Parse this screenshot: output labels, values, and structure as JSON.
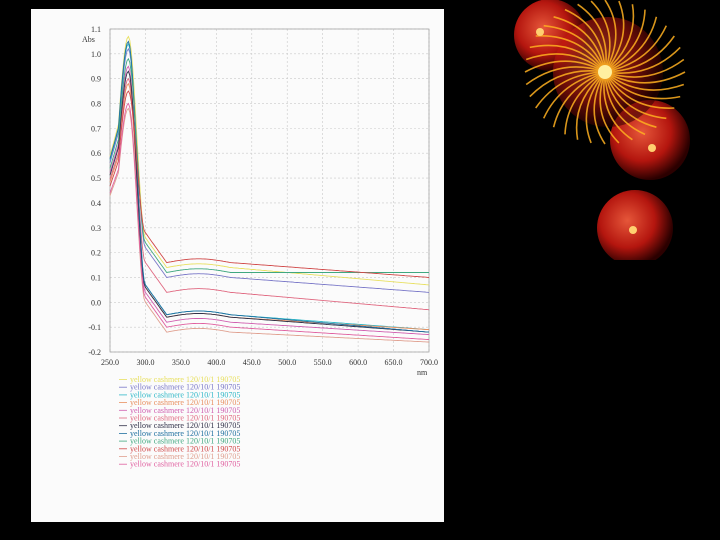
{
  "chart_data": {
    "type": "line",
    "ylabel": "Abs",
    "xlabel": "nm",
    "xlim": [
      250,
      700
    ],
    "ylim": [
      -0.2,
      1.1
    ],
    "xticks": [
      "250.0",
      "300.0",
      "350.0",
      "400.0",
      "450.0",
      "500.0",
      "550.0",
      "600.0",
      "650.0",
      "700.0"
    ],
    "yticks": [
      "-0.2",
      "-0.1",
      "0.0",
      "0.1",
      "0.2",
      "0.3",
      "0.4",
      "0.5",
      "0.6",
      "0.7",
      "0.8",
      "0.9",
      "1.0",
      "1.1"
    ],
    "grid": true,
    "legend_position": "bottom-left",
    "series": [
      {
        "name": "yellow cashmere 120/10/1 190705",
        "color": "#e8e060",
        "peak": 1.07,
        "base": 0.14,
        "drift": -0.07
      },
      {
        "name": "yellow cashmere 120/10/1 190705",
        "color": "#7a78c8",
        "peak": 1.02,
        "base": 0.1,
        "drift": -0.06
      },
      {
        "name": "yellow cashmere 120/10/1 190705",
        "color": "#30b8c8",
        "peak": 1.04,
        "base": -0.05,
        "drift": -0.06
      },
      {
        "name": "yellow cashmere 120/10/1 190705",
        "color": "#e89060",
        "peak": 0.88,
        "base": -0.06,
        "drift": -0.05
      },
      {
        "name": "yellow cashmere 120/10/1 190705",
        "color": "#d060b0",
        "peak": 0.95,
        "base": -0.08,
        "drift": -0.05
      },
      {
        "name": "yellow cashmere 120/10/1 190705",
        "color": "#e06880",
        "peak": 0.9,
        "base": 0.04,
        "drift": -0.07
      },
      {
        "name": "yellow cashmere 120/10/1 190705",
        "color": "#303048",
        "peak": 0.93,
        "base": -0.06,
        "drift": -0.06
      },
      {
        "name": "yellow cashmere 120/10/1 190705",
        "color": "#2070a0",
        "peak": 1.05,
        "base": -0.05,
        "drift": -0.07
      },
      {
        "name": "yellow cashmere 120/10/1 190705",
        "color": "#40a880",
        "peak": 0.98,
        "base": 0.12,
        "drift": 0.0
      },
      {
        "name": "yellow cashmere 120/10/1 190705",
        "color": "#d04848",
        "peak": 0.85,
        "base": 0.16,
        "drift": -0.06
      },
      {
        "name": "yellow cashmere 120/10/1 190705",
        "color": "#e0a090",
        "peak": 0.78,
        "base": -0.12,
        "drift": -0.04
      },
      {
        "name": "yellow cashmere 120/10/1 190705",
        "color": "#e060a0",
        "peak": 0.8,
        "base": -0.1,
        "drift": -0.05
      }
    ]
  },
  "decor": {
    "orb_color": "#c81810",
    "ray_color": "#ffb020"
  }
}
